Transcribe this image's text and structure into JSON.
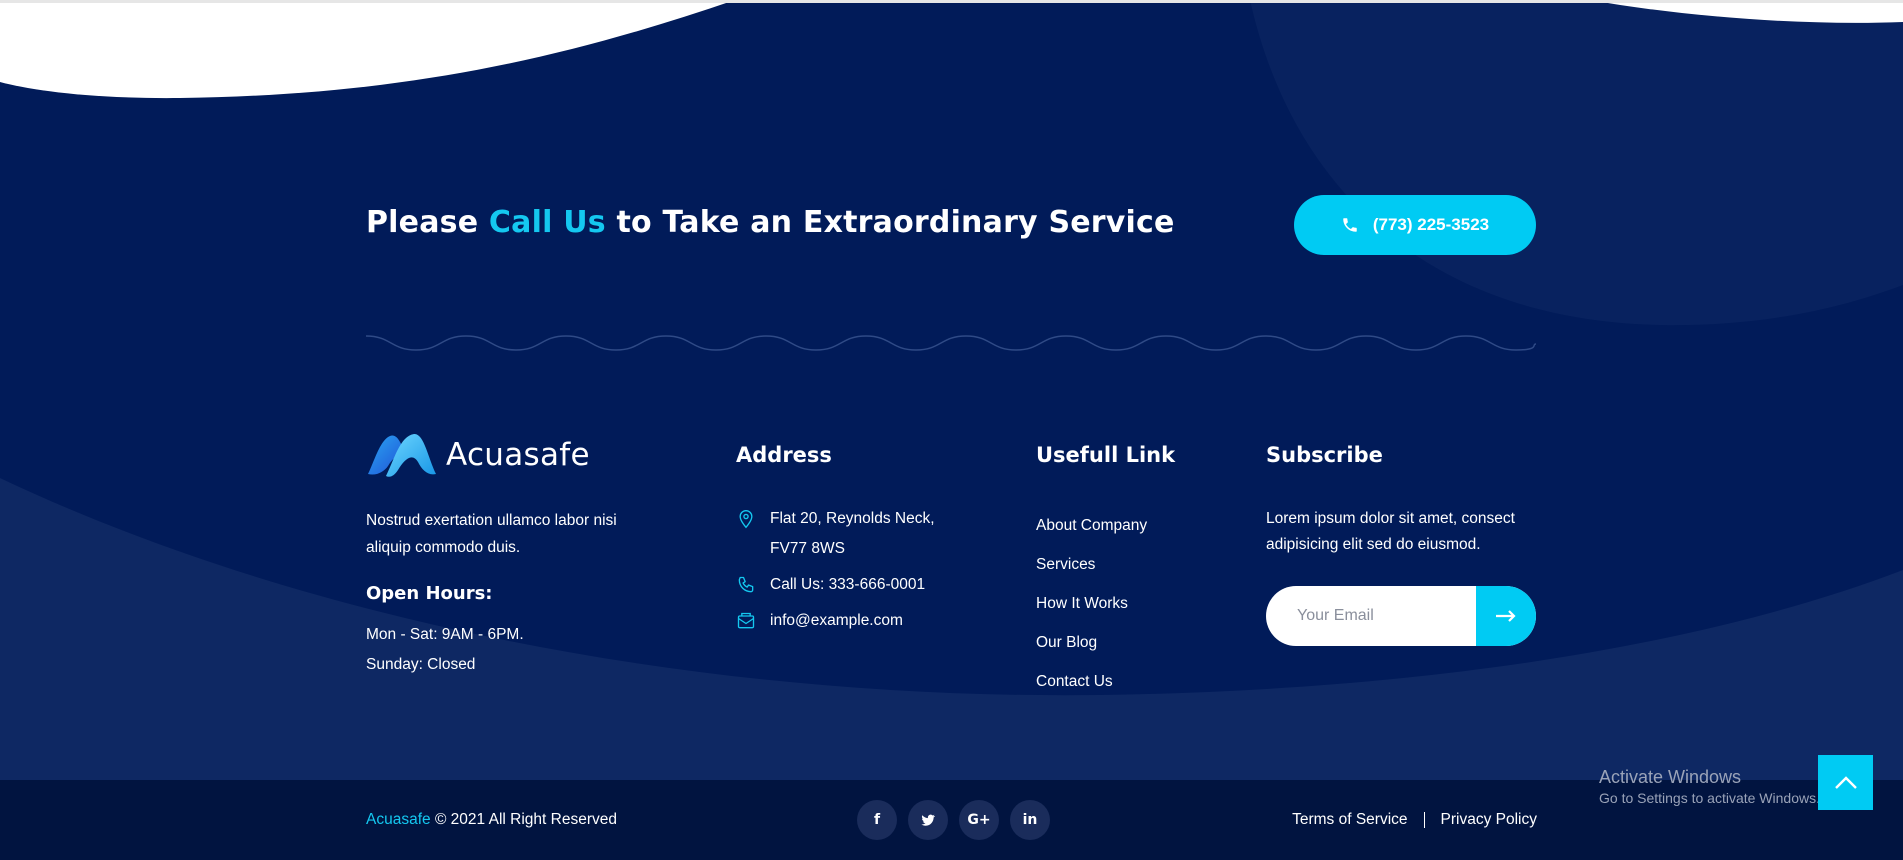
{
  "cta": {
    "prefix": "Please ",
    "accent": "Call Us",
    "suffix": " to Take an Extraordinary Service",
    "phone": "(773) 225-3523"
  },
  "brand": {
    "name": "Acuasafe",
    "description": "Nostrud exertation ullamco labor nisi aliquip commodo duis.",
    "hours_title": "Open Hours:",
    "hours": [
      "Mon - Sat: 9AM - 6PM.",
      "Sunday: Closed"
    ]
  },
  "address": {
    "title": "Address",
    "items": [
      {
        "icon": "map-pin-icon",
        "text": "Flat 20, Reynolds Neck, FV77 8WS"
      },
      {
        "icon": "phone-icon",
        "text": "Call Us: 333-666-0001"
      },
      {
        "icon": "mail-icon",
        "text": "info@example.com"
      }
    ]
  },
  "links": {
    "title": "Usefull Link",
    "items": [
      "About Company",
      "Services",
      "How It Works",
      "Our Blog",
      "Contact Us"
    ]
  },
  "subscribe": {
    "title": "Subscribe",
    "text": "Lorem ipsum dolor sit amet, consect adipisicing elit sed do eiusmod.",
    "placeholder": "Your Email"
  },
  "footer": {
    "brand": "Acuasafe",
    "copyright": " © 2021 All Right Reserved",
    "socials": [
      {
        "name": "facebook-icon",
        "glyph": "f"
      },
      {
        "name": "twitter-icon",
        "glyph": "t"
      },
      {
        "name": "google-plus-icon",
        "glyph": "G+"
      },
      {
        "name": "linkedin-icon",
        "glyph": "in"
      }
    ],
    "terms": "Terms of Service",
    "privacy": "Privacy Policy"
  },
  "watermark": {
    "line1": "Activate Windows",
    "line2": "Go to Settings to activate Windows."
  },
  "colors": {
    "background": "#011b59",
    "accent": "#00cbf3",
    "bottom_bar": "#011440"
  }
}
